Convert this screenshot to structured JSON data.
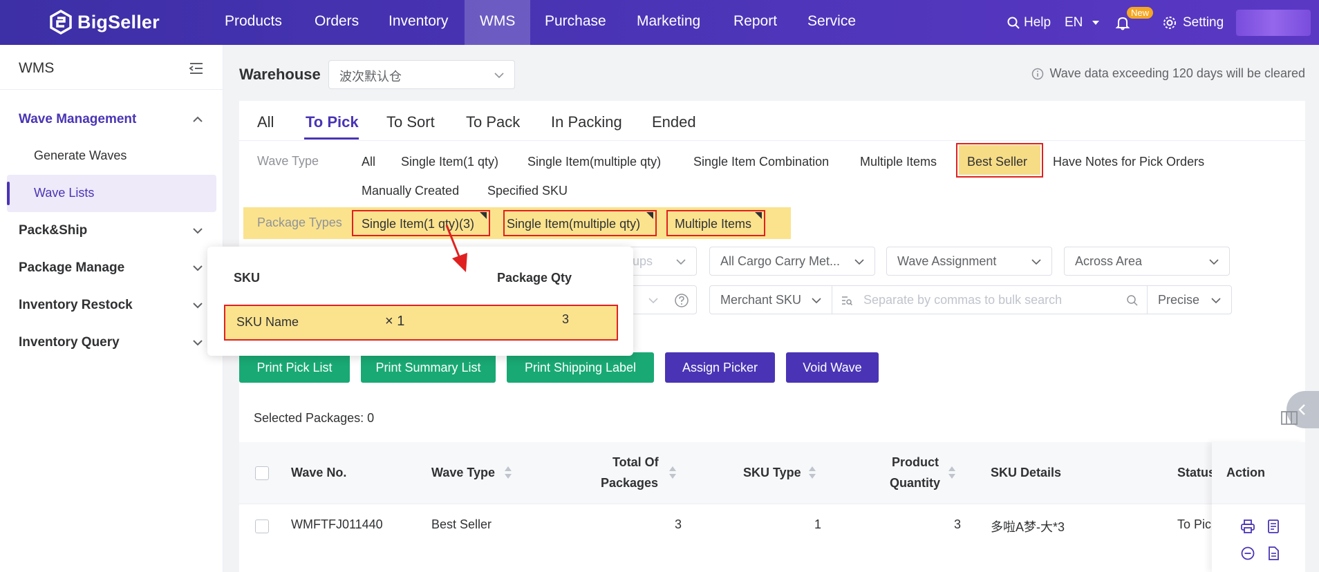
{
  "brand": {
    "name": "BigSeller"
  },
  "nav": {
    "items": [
      "Products",
      "Orders",
      "Inventory",
      "WMS",
      "Purchase",
      "Marketing",
      "Report",
      "Service"
    ],
    "active": "WMS",
    "help": "Help",
    "lang": "EN",
    "new_badge": "New",
    "setting": "Setting"
  },
  "sidebar": {
    "title": "WMS",
    "groups": [
      {
        "label": "Wave Management",
        "expanded": true,
        "items": [
          "Generate Waves",
          "Wave Lists"
        ],
        "active_item": "Wave Lists"
      },
      {
        "label": "Pack&Ship"
      },
      {
        "label": "Package Manage"
      },
      {
        "label": "Inventory Restock"
      },
      {
        "label": "Inventory Query"
      }
    ]
  },
  "warehouse": {
    "label": "Warehouse",
    "value": "波次默认仓",
    "notice": "Wave data exceeding 120 days will be cleared"
  },
  "tabs": {
    "items": [
      "All",
      "To Pick",
      "To Sort",
      "To Pack",
      "In Packing",
      "Ended"
    ],
    "active": "To Pick"
  },
  "wave_type": {
    "label": "Wave Type",
    "options": [
      "All",
      "Single Item(1 qty)",
      "Single Item(multiple qty)",
      "Single Item Combination",
      "Multiple Items",
      "Best Seller",
      "Have Notes for Pick Orders",
      "Manually Created",
      "Specified SKU"
    ],
    "selected": "Best Seller"
  },
  "package_types": {
    "label": "Package Types",
    "options": [
      "Single Item(1 qty)(3)",
      "Single Item(multiple qty)",
      "Multiple Items"
    ]
  },
  "filters": {
    "groups_partial": "ups",
    "cargo": "All Cargo Carry Met...",
    "assignment": "Wave Assignment",
    "area": "Across Area",
    "merchant_sku": "Merchant SKU",
    "search_placeholder": "Separate by commas to bulk search",
    "match": "Precise"
  },
  "popover": {
    "col_sku": "SKU",
    "col_qty": "Package Qty",
    "rows": [
      {
        "sku": "SKU Name",
        "multiplier": "× 1",
        "qty": "3"
      }
    ]
  },
  "buttons": [
    "Print Pick List",
    "Print Summary List",
    "Print Shipping Label",
    "Assign Picker",
    "Void Wave"
  ],
  "table": {
    "selected_text": "Selected Packages: 0",
    "headers": {
      "wave_no": "Wave No.",
      "wave_type": "Wave Type",
      "total_packages_1": "Total Of",
      "total_packages_2": "Packages",
      "sku_type": "SKU Type",
      "product_qty_1": "Product",
      "product_qty_2": "Quantity",
      "sku_details": "SKU Details",
      "status": "Status",
      "action": "Action"
    },
    "rows": [
      {
        "wave_no": "WMFTFJ011440",
        "wave_type": "Best Seller",
        "total_packages": "3",
        "sku_type": "1",
        "product_quantity": "3",
        "sku_details": "多啦A梦-大*3",
        "status": "To Pick"
      }
    ]
  },
  "colors": {
    "brand": "#4a34b5",
    "green": "#19a974",
    "highlight": "#fbe38e",
    "annotation": "#e02020"
  }
}
